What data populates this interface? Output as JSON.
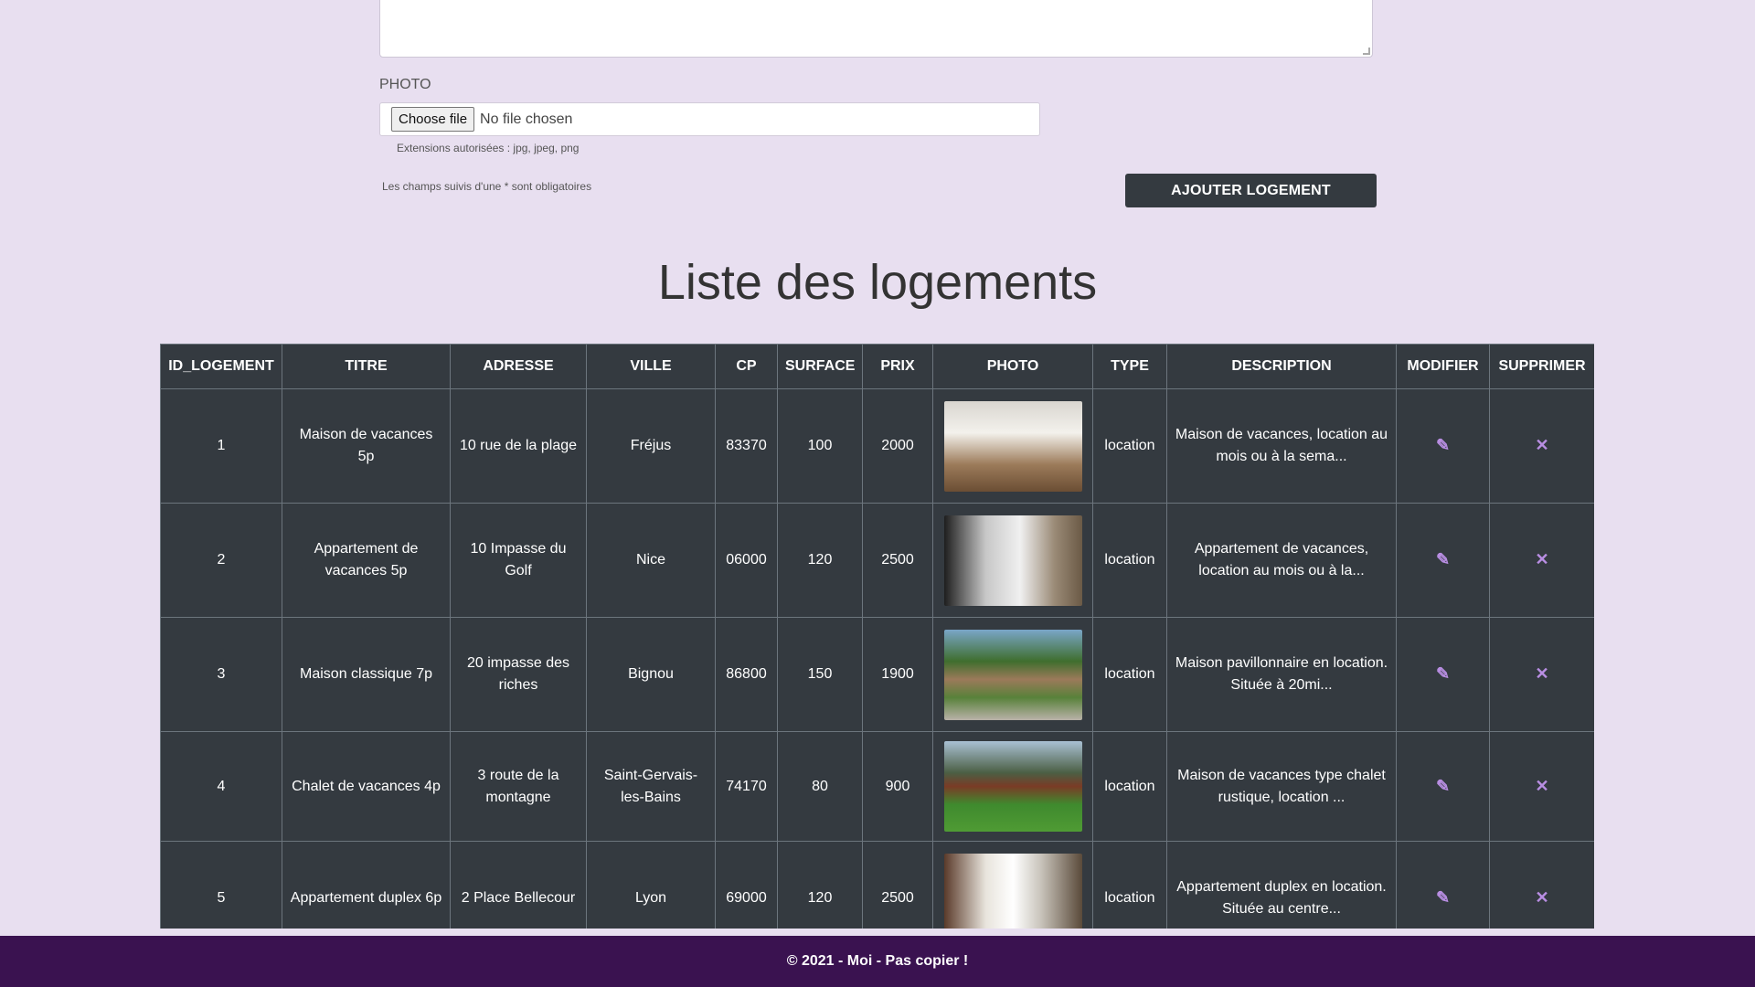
{
  "form": {
    "photo_label": "PHOTO",
    "file_button": "Choose file",
    "file_status": "No file chosen",
    "extensions_hint": "Extensions autorisées : jpg, jpeg, png",
    "required_note": "Les champs suivis d'une * sont obligatoires",
    "submit_label": "AJOUTER LOGEMENT"
  },
  "list_title": "Liste des logements",
  "table": {
    "headers": [
      "ID_LOGEMENT",
      "TITRE",
      "ADRESSE",
      "VILLE",
      "CP",
      "SURFACE",
      "PRIX",
      "PHOTO",
      "TYPE",
      "DESCRIPTION",
      "MODIFIER",
      "SUPPRIMER"
    ],
    "rows": [
      {
        "id": "1",
        "titre": "Maison de vacances 5p",
        "adresse": "10 rue de la plage",
        "ville": "Fréjus",
        "cp": "83370",
        "surface": "100",
        "prix": "2000",
        "photo": "kitchen-interior",
        "type": "location",
        "description": "Maison de vacances, location au mois ou à la sema..."
      },
      {
        "id": "2",
        "titre": "Appartement de vacances 5p",
        "adresse": "10 Impasse du Golf",
        "ville": "Nice",
        "cp": "06000",
        "surface": "120",
        "prix": "2500",
        "photo": "open-living-room",
        "type": "location",
        "description": "Appartement de vacances, location au mois ou à la..."
      },
      {
        "id": "3",
        "titre": "Maison classique 7p",
        "adresse": "20 impasse des riches",
        "ville": "Bignou",
        "cp": "86800",
        "surface": "150",
        "prix": "1900",
        "photo": "house-exterior",
        "type": "location",
        "description": "Maison pavillonnaire en location. Située à 20mi..."
      },
      {
        "id": "4",
        "titre": "Chalet de vacances 4p",
        "adresse": "3 route de la montagne",
        "ville": "Saint-Gervais-les-Bains",
        "cp": "74170",
        "surface": "80",
        "prix": "900",
        "photo": "chalet-garden",
        "type": "location",
        "description": "Maison de vacances type chalet rustique, location ..."
      },
      {
        "id": "5",
        "titre": "Appartement duplex 6p",
        "adresse": "2 Place Bellecour",
        "ville": "Lyon",
        "cp": "69000",
        "surface": "120",
        "prix": "2500",
        "photo": "duplex-living-room",
        "type": "location",
        "description": "Appartement duplex en location. Située au centre..."
      }
    ],
    "edit_icon": "pencil-icon",
    "delete_icon": "close-icon"
  },
  "footer": {
    "text": "© 2021 - Moi - Pas copier !"
  },
  "colors": {
    "page_background": "#e8dff0",
    "table_background": "#343a40",
    "footer_background": "#3a1250",
    "icon_accent": "#b98ee3"
  }
}
